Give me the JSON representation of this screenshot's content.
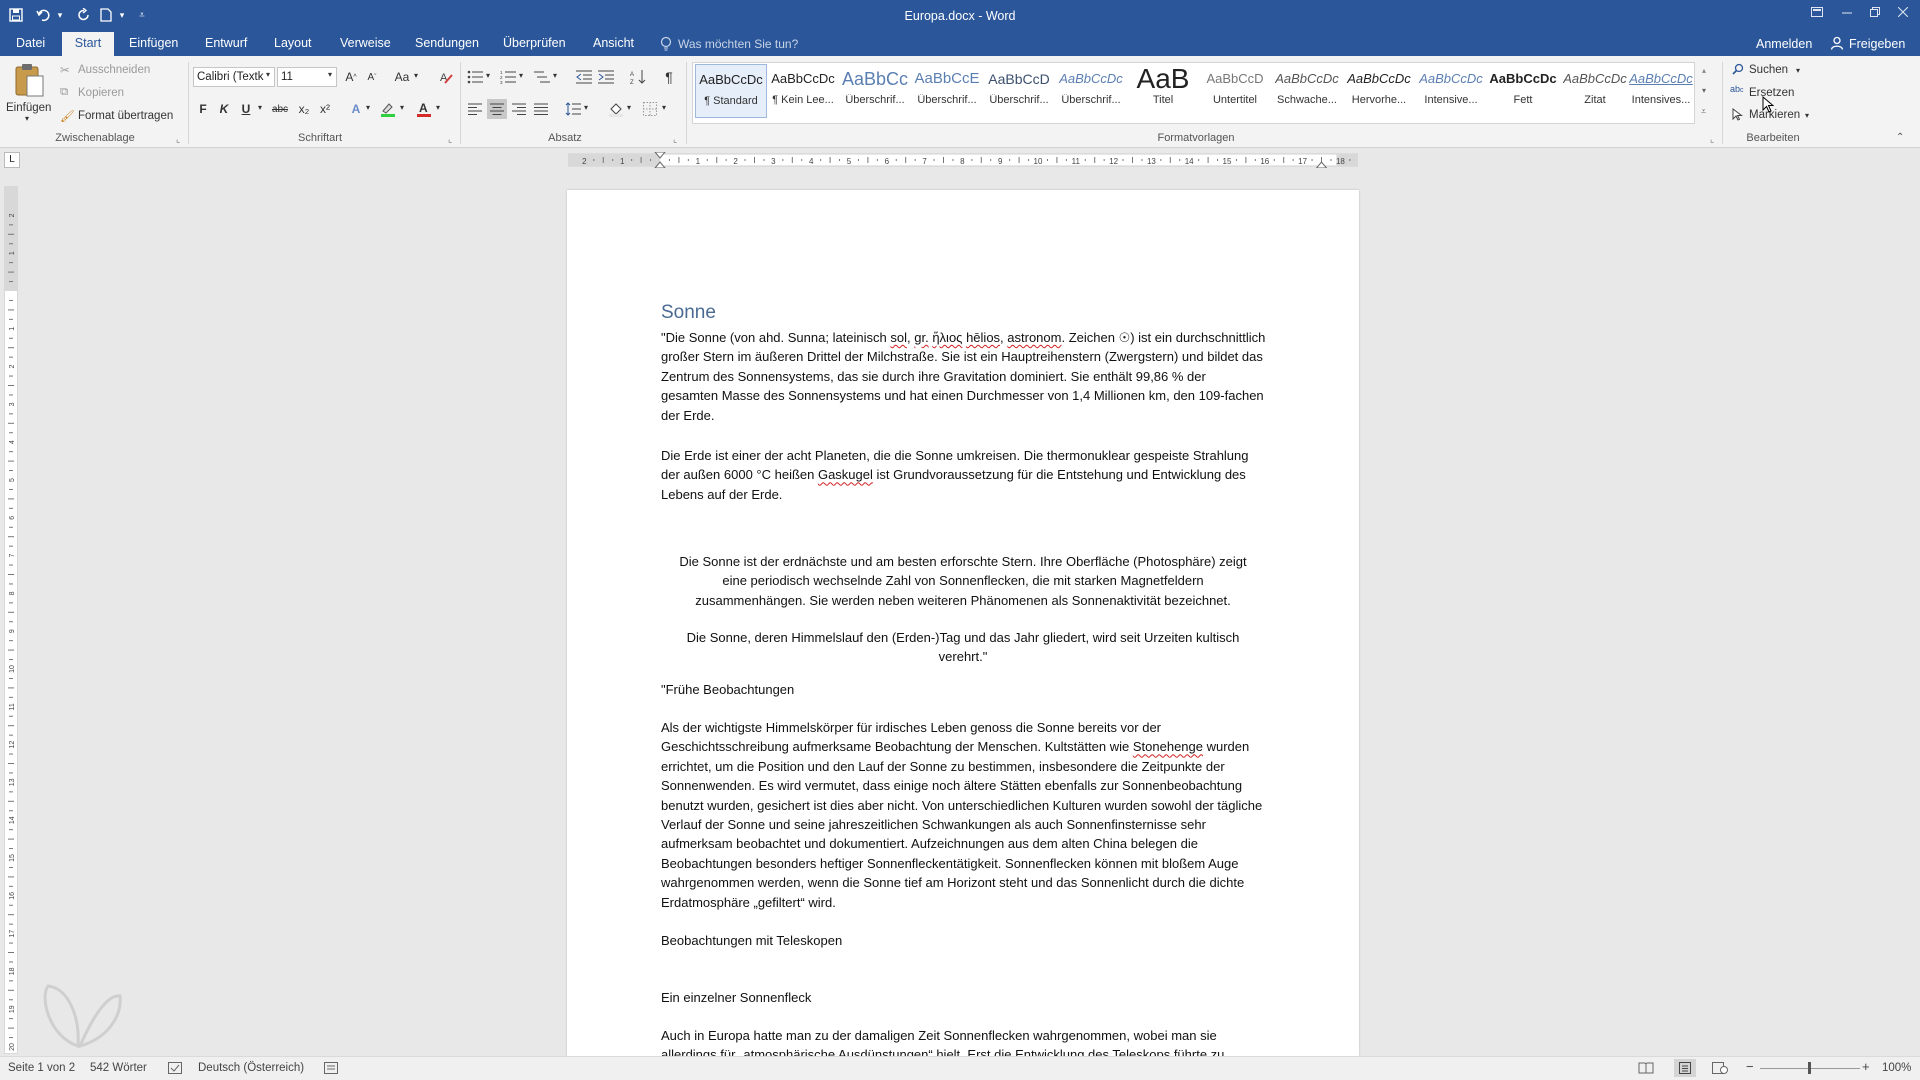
{
  "window": {
    "title": "Europa.docx - Word"
  },
  "tabs": [
    {
      "label": "Datei"
    },
    {
      "label": "Start"
    },
    {
      "label": "Einfügen"
    },
    {
      "label": "Entwurf"
    },
    {
      "label": "Layout"
    },
    {
      "label": "Verweise"
    },
    {
      "label": "Sendungen"
    },
    {
      "label": "Überprüfen"
    },
    {
      "label": "Ansicht"
    }
  ],
  "tell_me": {
    "placeholder": "Was möchten Sie tun?"
  },
  "account": {
    "signin": "Anmelden",
    "share": "Freigeben"
  },
  "ribbon": {
    "clipboard": {
      "paste": "Einfügen",
      "cut": "Ausschneiden",
      "copy": "Kopieren",
      "format_painter": "Format übertragen",
      "label": "Zwischenablage"
    },
    "font": {
      "name": "Calibri (Textk",
      "size": "11",
      "bold": "F",
      "italic": "K",
      "underline": "U",
      "strike": "abc",
      "sub": "x₂",
      "sup": "x²",
      "case": "Aa",
      "label": "Schriftart",
      "font_color": "#d62b2b",
      "highlight_color": "#2fcf3f"
    },
    "paragraph": {
      "label": "Absatz"
    },
    "styles": {
      "label": "Formatvorlagen",
      "items": [
        {
          "preview": "AaBbCcDc",
          "name": "¶ Standard"
        },
        {
          "preview": "AaBbCcDc",
          "name": "¶ Kein Lee..."
        },
        {
          "preview": "AaBbCc",
          "name": "Überschrif..."
        },
        {
          "preview": "AaBbCcE",
          "name": "Überschrif..."
        },
        {
          "preview": "AaBbCcD",
          "name": "Überschrif..."
        },
        {
          "preview": "AaBbCcDc",
          "name": "Überschrif..."
        },
        {
          "preview": "AaB",
          "name": "Titel"
        },
        {
          "preview": "AaBbCcD",
          "name": "Untertitel"
        },
        {
          "preview": "AaBbCcDc",
          "name": "Schwache..."
        },
        {
          "preview": "AaBbCcDc",
          "name": "Hervorhe..."
        },
        {
          "preview": "AaBbCcDc",
          "name": "Intensive..."
        },
        {
          "preview": "AaBbCcDc",
          "name": "Fett"
        },
        {
          "preview": "AaBbCcDc",
          "name": "Zitat"
        },
        {
          "preview": "AaBbCcDc",
          "name": "Intensives..."
        }
      ]
    },
    "editing": {
      "find": "Suchen",
      "replace": "Ersetzen",
      "select": "Markieren",
      "label": "Bearbeiten"
    }
  },
  "ruler": {
    "marks": [
      "2",
      "1",
      "1",
      "2",
      "3",
      "4",
      "5",
      "6",
      "7",
      "8",
      "9",
      "10",
      "11",
      "12",
      "13",
      "14",
      "15",
      "16",
      "17",
      "18"
    ]
  },
  "document": {
    "heading": "Sonne",
    "p1": {
      "a": "\"Die Sonne (von ahd. Sunna; lateinisch ",
      "b": "sol",
      "c": ", ",
      "d": "gr.",
      "e": " ",
      "f": "ἥλιος",
      "g": " ",
      "h": "hēlios",
      "i": ", ",
      "j": "astronom",
      "k": ". Zeichen ☉) ist ein durchschnittlich großer Stern im äußeren Drittel der Milchstraße. Sie ist ein Hauptreihenstern (Zwergstern) und bildet das Zentrum des Sonnensystems, das sie durch ihre Gravitation dominiert. Sie enthält 99,86 % der gesamten Masse des Sonnensystems und hat einen Durchmesser von 1,4 Millionen km, den 109-fachen der Erde."
    },
    "p2": {
      "a": "Die Erde ist einer der acht Planeten, die die Sonne umkreisen. Die thermonuklear gespeiste Strahlung der außen 6000 °C heißen ",
      "b": "Gaskugel",
      "c": " ist Grundvoraussetzung für die Entstehung und Entwicklung des Lebens auf der Erde."
    },
    "p3": "Die Sonne ist der erdnächste und am besten erforschte Stern. Ihre Oberfläche (Photosphäre) zeigt eine periodisch wechselnde Zahl von Sonnenflecken, die mit starken Magnetfeldern zusammenhängen. Sie werden neben weiteren Phänomenen als Sonnenaktivität bezeichnet.",
    "p4": "Die Sonne, deren Himmelslauf den (Erden-)Tag und das Jahr gliedert, wird seit Urzeiten kultisch verehrt.\"",
    "p5": "\"Frühe Beobachtungen",
    "p6": {
      "a": "Als der wichtigste Himmelskörper für irdisches Leben genoss die Sonne bereits vor der Geschichtsschreibung aufmerksame Beobachtung der Menschen. Kultstätten wie ",
      "b": "Stonehenge",
      "c": " wurden errichtet, um die Position und den Lauf der Sonne zu bestimmen, insbesondere die Zeitpunkte der Sonnenwenden. Es wird vermutet, dass einige noch ältere Stätten ebenfalls zur Sonnenbeobachtung benutzt wurden, gesichert ist dies aber nicht. Von unterschiedlichen Kulturen wurden sowohl der tägliche Verlauf der Sonne und seine jahreszeitlichen Schwankungen als auch Sonnenfinsternisse sehr aufmerksam beobachtet und dokumentiert. Aufzeichnungen aus dem alten China belegen die Beobachtungen besonders heftiger Sonnenfleckentätigkeit. Sonnenflecken können mit bloßem Auge wahrgenommen werden, wenn die Sonne tief am Horizont steht und das Sonnenlicht durch die dichte Erdatmosphäre „gefiltert“ wird."
    },
    "p7": "Beobachtungen mit Teleskopen",
    "p8": "Ein einzelner Sonnenfleck",
    "p9": "Auch in Europa hatte man zu der damaligen Zeit Sonnenflecken wahrgenommen, wobei man sie allerdings für „atmosphärische Ausdünstungen“ hielt. Erst die Entwicklung des Teleskops führte zu"
  },
  "statusbar": {
    "page": "Seite 1 von 2",
    "words": "542 Wörter",
    "language": "Deutsch (Österreich)",
    "zoom": "100%"
  }
}
